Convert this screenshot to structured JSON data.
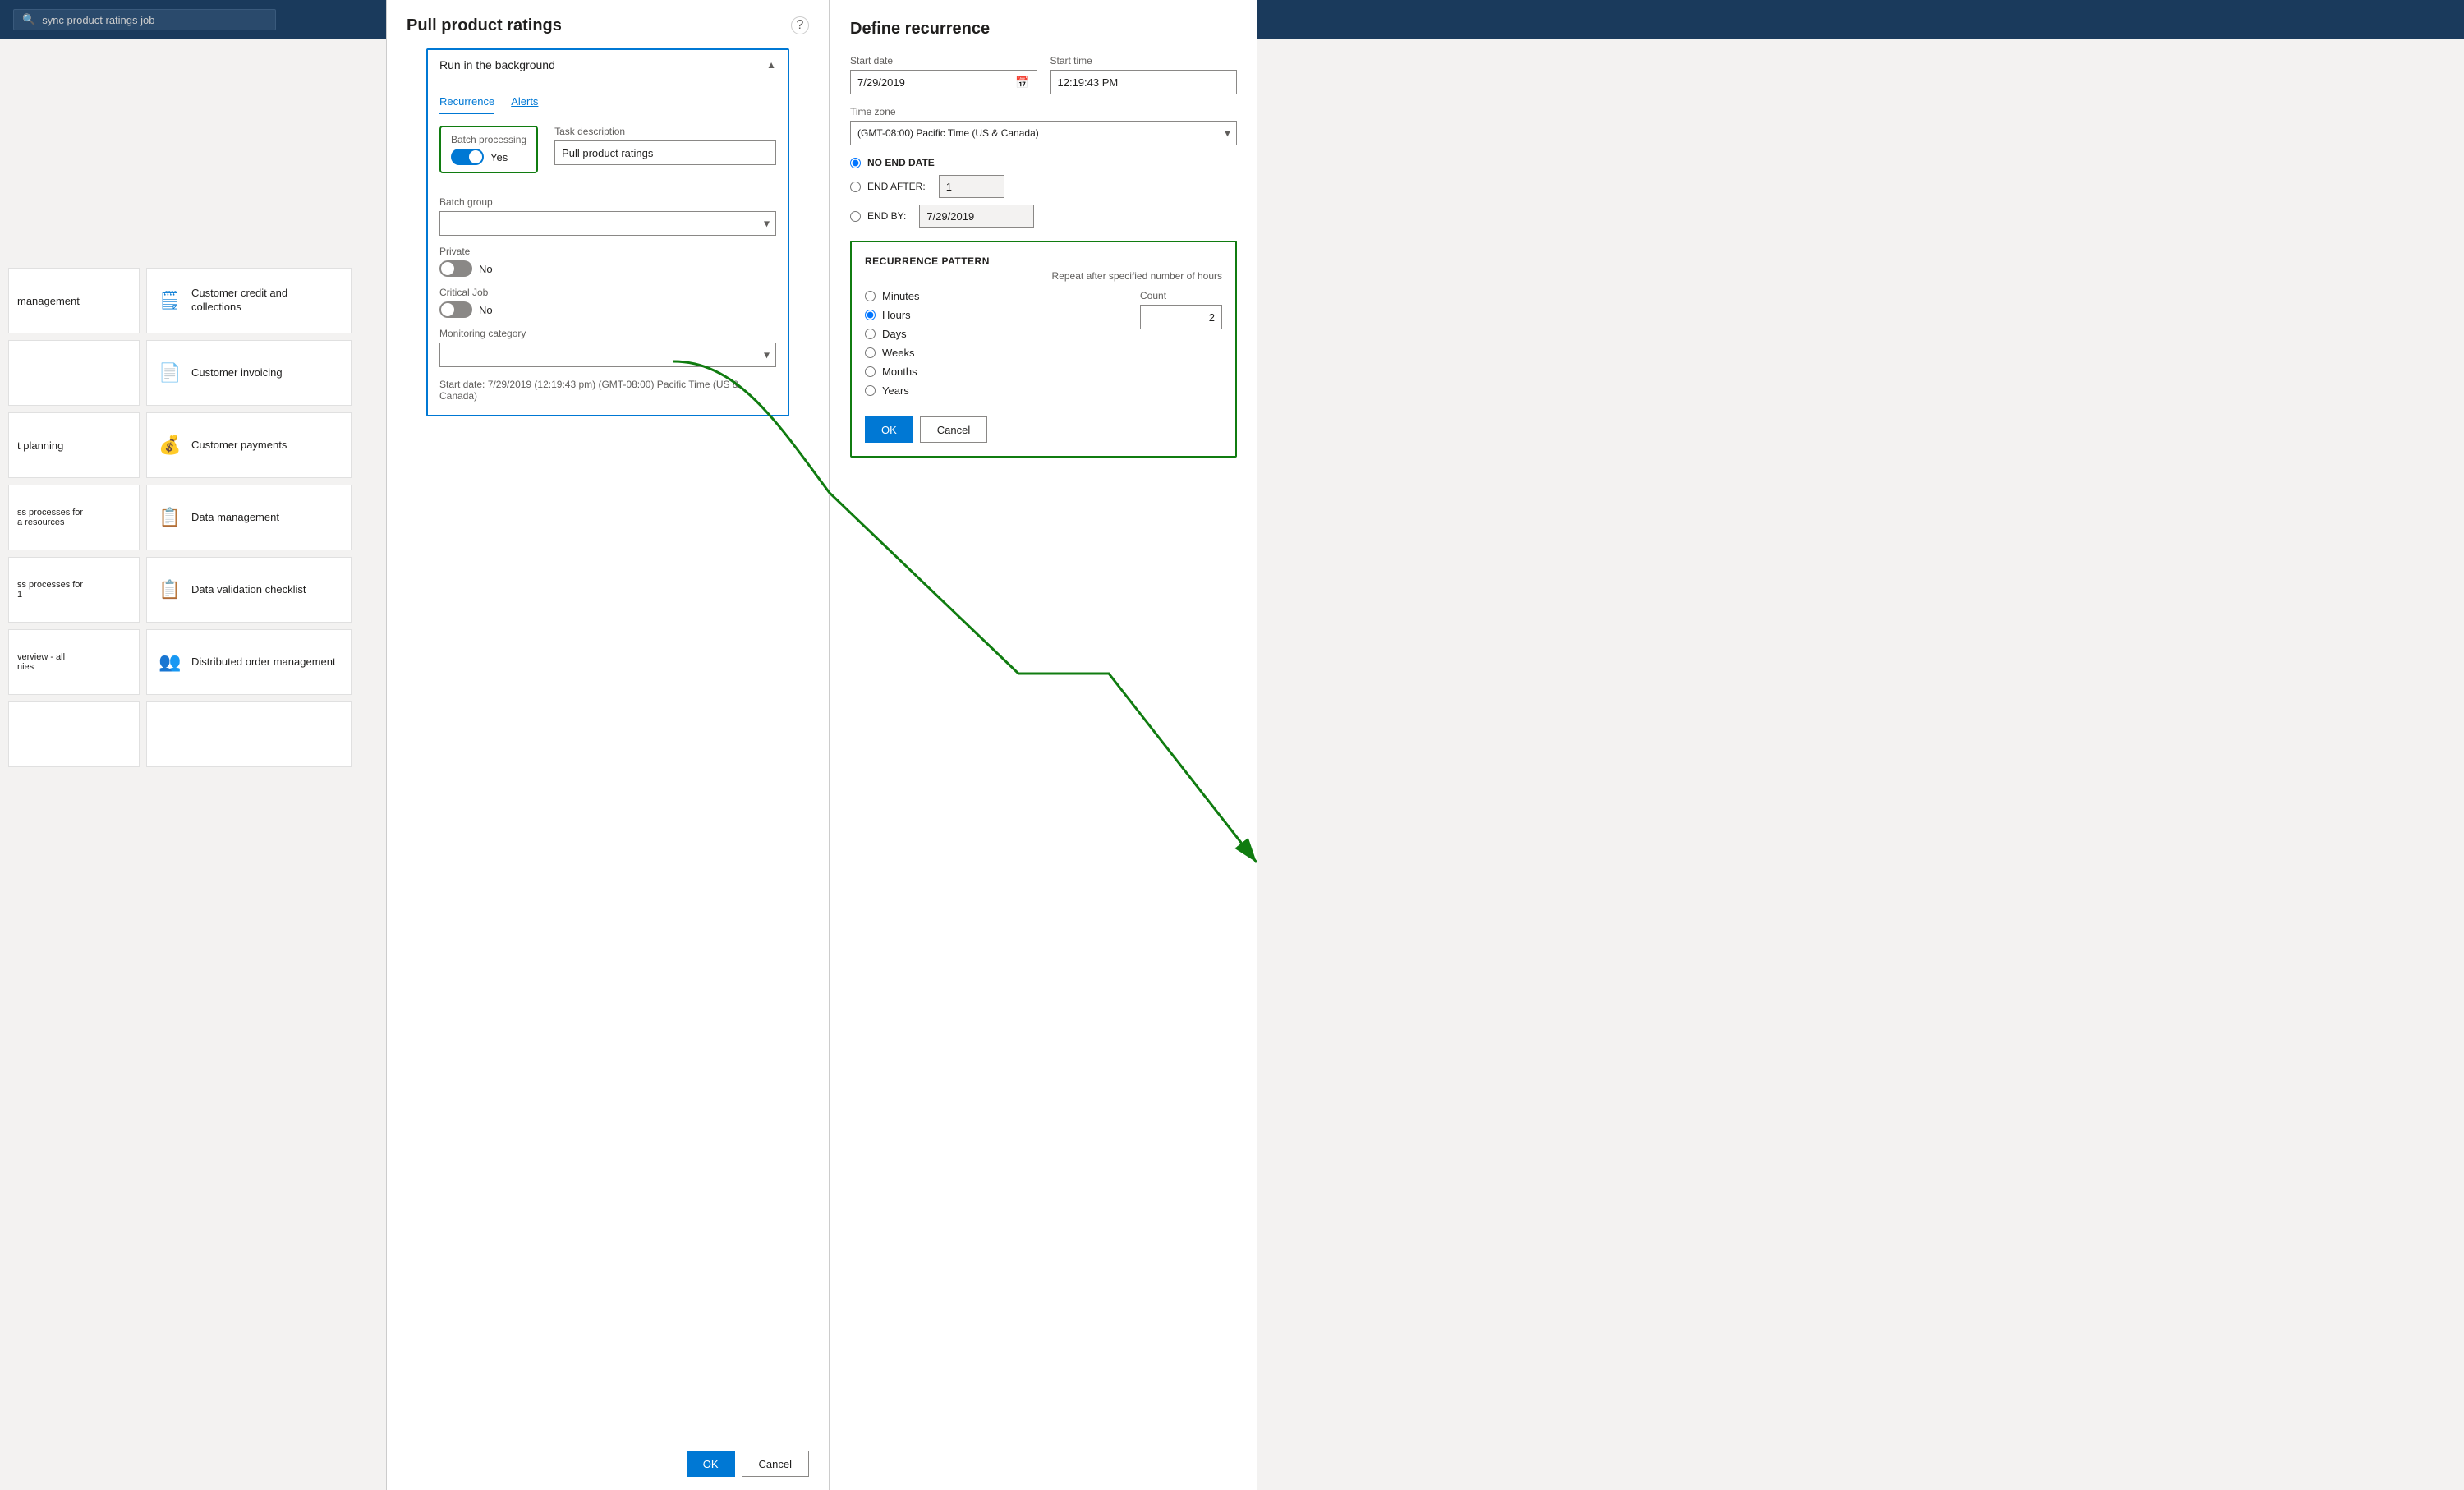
{
  "topBar": {
    "searchPlaceholder": "sync product ratings job"
  },
  "leftPanel": {
    "tiles": [
      {
        "id": "management",
        "leftLabel": "management",
        "icon": "📋",
        "label": ""
      },
      {
        "id": "customer-credit",
        "leftLabel": "",
        "icon": "🗒",
        "label": "Customer credit and collections"
      },
      {
        "id": "customer-invoicing",
        "leftLabel": "",
        "icon": "📄",
        "label": "Customer invoicing"
      },
      {
        "id": "t-planning",
        "leftLabel": "t planning",
        "icon": "💰",
        "label": "Customer payments"
      },
      {
        "id": "ss-resources",
        "leftLabel": "ss processes for\na resources",
        "icon": "📋",
        "label": "Data management"
      },
      {
        "id": "ss-data",
        "leftLabel": "ss processes for\n1",
        "icon": "📋",
        "label": "Data validation checklist"
      },
      {
        "id": "verview",
        "leftLabel": "verview - all\nnies",
        "icon": "👥",
        "label": "Distributed order management"
      }
    ],
    "rightIcons": [
      "👤",
      "⚙",
      "📊",
      "📅",
      "👥"
    ]
  },
  "pullProductRatingsDialog": {
    "title": "Pull product ratings",
    "helpIcon": "?",
    "runInBackground": {
      "label": "Run in the background",
      "expanded": true
    },
    "tabs": [
      {
        "id": "recurrence",
        "label": "Recurrence",
        "active": true
      },
      {
        "id": "alerts",
        "label": "Alerts",
        "active": false
      }
    ],
    "batchProcessing": {
      "label": "Batch processing",
      "value": "Yes",
      "enabled": true
    },
    "taskDescription": {
      "label": "Task description",
      "value": "Pull product ratings"
    },
    "batchGroup": {
      "label": "Batch group",
      "value": ""
    },
    "private": {
      "label": "Private",
      "value": "No",
      "enabled": false
    },
    "criticalJob": {
      "label": "Critical Job",
      "value": "No",
      "enabled": false
    },
    "monitoringCategory": {
      "label": "Monitoring category",
      "value": ""
    },
    "startDateInfo": "Start date: 7/29/2019 (12:19:43 pm) (GMT-08:00) Pacific Time (US & Canada)",
    "buttons": {
      "ok": "OK",
      "cancel": "Cancel"
    }
  },
  "defineRecurrence": {
    "title": "Define recurrence",
    "startDate": {
      "label": "Start date",
      "value": "7/29/2019"
    },
    "startTime": {
      "label": "Start time",
      "value": "12:19:43 PM"
    },
    "timeZone": {
      "label": "Time zone",
      "value": "(GMT-08:00) Pacific Time (US & Canada)"
    },
    "endOptions": {
      "noEndDate": {
        "label": "NO END DATE",
        "selected": true
      },
      "endAfter": {
        "label": "END AFTER:",
        "value": "1",
        "selected": false
      },
      "endBy": {
        "label": "END BY:",
        "value": "7/29/2019",
        "selected": false
      }
    },
    "recurrencePattern": {
      "title": "RECURRENCE PATTERN",
      "subtitle": "Repeat after specified number of hours",
      "options": [
        {
          "id": "minutes",
          "label": "Minutes",
          "selected": false
        },
        {
          "id": "hours",
          "label": "Hours",
          "selected": true
        },
        {
          "id": "days",
          "label": "Days",
          "selected": false
        },
        {
          "id": "weeks",
          "label": "Weeks",
          "selected": false
        },
        {
          "id": "months",
          "label": "Months",
          "selected": false
        },
        {
          "id": "years",
          "label": "Years",
          "selected": false
        }
      ],
      "count": {
        "label": "Count",
        "value": "2"
      },
      "buttons": {
        "ok": "OK",
        "cancel": "Cancel"
      }
    }
  }
}
